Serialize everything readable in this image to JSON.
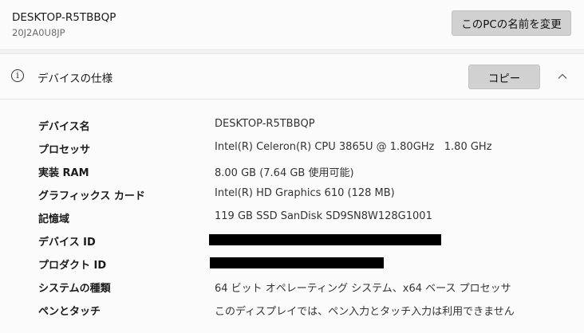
{
  "device": {
    "name": "DESKTOP-R5TBBQP",
    "model": "20J2A0U8JP",
    "rename_label": "このPCの名前を変更"
  },
  "spec_section": {
    "title": "デバイスの仕様",
    "copy_label": "コピー",
    "info_icon": "info-icon",
    "collapse_icon": "chevron-up-icon",
    "expanded": true
  },
  "specs": [
    {
      "label": "デバイス名",
      "value": "DESKTOP-R5TBBQP",
      "redacted": false
    },
    {
      "label": "プロセッサ",
      "value": "Intel(R) Celeron(R) CPU 3865U @ 1.80GHz   1.80 GHz",
      "redacted": false
    },
    {
      "label": "実装 RAM",
      "value": "8.00 GB (7.64 GB 使用可能)",
      "redacted": false
    },
    {
      "label": "グラフィックス カード",
      "value": "Intel(R) HD Graphics 610 (128 MB)",
      "redacted": false
    },
    {
      "label": "記憶域",
      "value": "119 GB SSD SanDisk SD9SN8W128G1001",
      "redacted": false
    },
    {
      "label": "デバイス ID",
      "value": "",
      "redacted": true
    },
    {
      "label": "プロダクト ID",
      "value": "",
      "redacted": true
    },
    {
      "label": "システムの種類",
      "value": "64 ビット オペレーティング システム、x64 ベース プロセッサ",
      "redacted": false
    },
    {
      "label": "ペンとタッチ",
      "value": "このディスプレイでは、ペン入力とタッチ入力は利用できません",
      "redacted": false
    }
  ],
  "colors": {
    "background": "#f3f3f3",
    "card": "#fbfbfb",
    "button": "#d1d1d1",
    "redaction": "#000000"
  }
}
